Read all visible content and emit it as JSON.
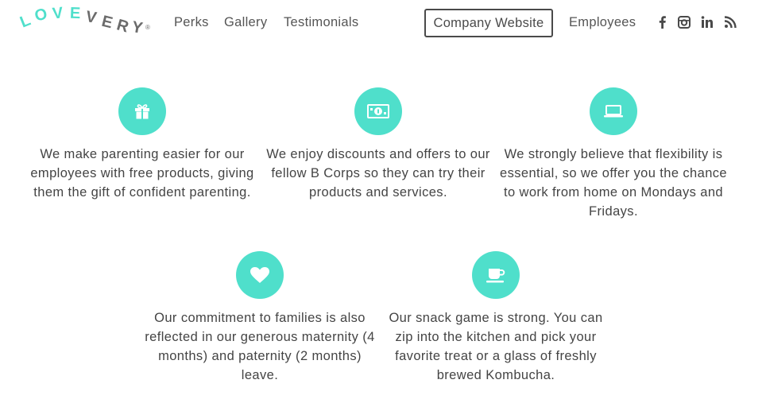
{
  "brand": {
    "letters": [
      "L",
      "O",
      "V",
      "E",
      "V",
      "E",
      "R",
      "Y"
    ],
    "trademark": "®",
    "colors": {
      "teal": "#4fdfcb",
      "gray": "#6b6b6b"
    }
  },
  "nav": {
    "links": [
      "Perks",
      "Gallery",
      "Testimonials"
    ],
    "company_button": "Company Website",
    "employees": "Employees",
    "social_icons": [
      "facebook-icon",
      "instagram-icon",
      "linkedin-icon",
      "rss-icon"
    ]
  },
  "accent_color": "#4fdfcb",
  "perks": [
    {
      "icon": "gift-icon",
      "text": "We make parenting easier for our employees with free products, giving them the gift of confident parenting."
    },
    {
      "icon": "money-icon",
      "text": "We enjoy discounts and offers to our fellow B Corps so they can try their products and services."
    },
    {
      "icon": "laptop-icon",
      "text": "We strongly believe that flexibility is essential, so we offer you the chance to work from home on Mondays and Fridays."
    },
    {
      "icon": "heart-icon",
      "text": "Our commitment to families is also reflected in our generous maternity (4 months) and paternity (2 months) leave."
    },
    {
      "icon": "coffee-cup-icon",
      "text": "Our snack game is strong. You can zip into the kitchen and pick your favorite treat or a glass of freshly brewed Kombucha."
    }
  ]
}
